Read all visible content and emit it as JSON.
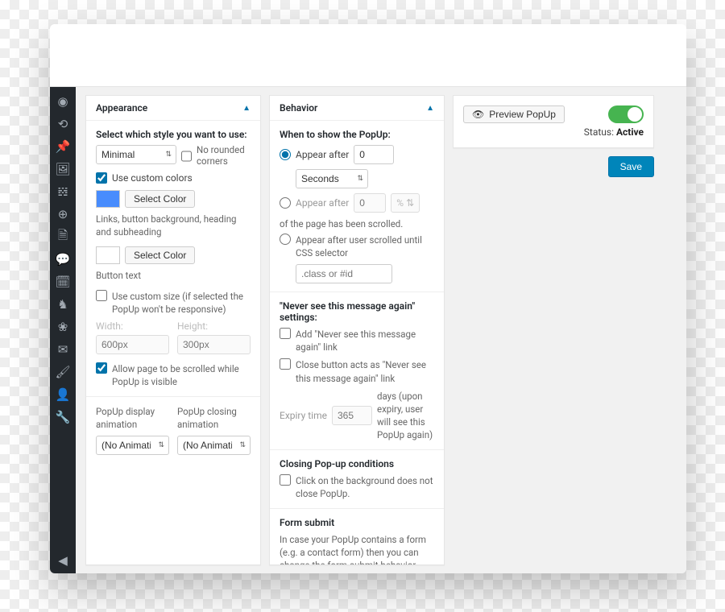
{
  "appearance": {
    "title": "Appearance",
    "style_label": "Select which style you want to use:",
    "style_value": "Minimal",
    "no_rounded_label": "No rounded corners",
    "use_custom_colors_label": "Use custom colors",
    "select_color_label": "Select Color",
    "color1_hint": "Links, button background, heading and subheading",
    "color2_hint": "Button text",
    "use_custom_size_label": "Use custom size (if selected the PopUp won't be responsive)",
    "width_label": "Width:",
    "width_placeholder": "600px",
    "height_label": "Height:",
    "height_placeholder": "300px",
    "allow_scroll_label": "Allow page to be scrolled while PopUp is visible",
    "display_animation_label": "PopUp display animation",
    "closing_animation_label": "PopUp closing animation",
    "animation_value": "(No Animation)"
  },
  "behavior": {
    "title": "Behavior",
    "when_label": "When to show the PopUp:",
    "appear_after_label": "Appear after",
    "appear_after_value": "0",
    "seconds_label": "Seconds",
    "appear_after_scroll_label": "Appear after",
    "appear_after_scroll_value": "0",
    "pct_symbol": "%",
    "scroll_hint": "of the page has been scrolled.",
    "appear_css_label": "Appear after user scrolled until CSS selector",
    "css_placeholder": ".class or #id",
    "never_heading": "\"Never see this message again\" settings:",
    "never_add_label": "Add \"Never see this message again\" link",
    "never_close_label": "Close button acts as \"Never see this message again\" link",
    "expiry_label": "Expiry time",
    "expiry_value": "365",
    "expiry_hint": "days (upon expiry, user will see this PopUp again)",
    "closing_heading": "Closing Pop-up conditions",
    "closing_bg_label": "Click on the background does not close PopUp.",
    "form_heading": "Form submit",
    "form_hint": "In case your PopUp contains a form (e.g. a contact form) then you can change the form-submit behavior"
  },
  "side": {
    "preview_label": "Preview PopUp",
    "status_prefix": "Status: ",
    "status_value": "Active",
    "save_label": "Save"
  }
}
